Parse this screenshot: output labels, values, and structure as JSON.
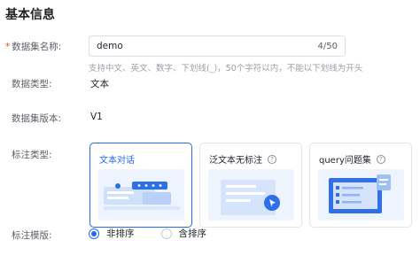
{
  "section": {
    "title": "基本信息"
  },
  "fields": {
    "name": {
      "label": "数据集名称:",
      "required_mark": "*",
      "value": "demo",
      "counter": "4/50",
      "hint": "支持中文、英文、数字、下划线(_)，50个字符以内，不能以下划线为开头"
    },
    "type": {
      "label": "数据类型:",
      "value": "文本"
    },
    "version": {
      "label": "数据集版本:",
      "value": "V1"
    },
    "annotation_type": {
      "label": "标注类型:",
      "options": [
        {
          "label": "文本对话",
          "selected": true,
          "help_icon": false
        },
        {
          "label": "泛文本无标注",
          "selected": false,
          "help_icon": true
        },
        {
          "label": "query问题集",
          "selected": false,
          "help_icon": true
        }
      ]
    },
    "template": {
      "label": "标注模版:",
      "options": [
        {
          "label": "非排序",
          "selected": true
        },
        {
          "label": "含排序",
          "selected": false
        }
      ]
    }
  },
  "colors": {
    "accent": "#2468f2",
    "required": "#e8473a",
    "illustration_bg": "#eef4fd"
  },
  "icons": {
    "help": "question-circle-icon",
    "cursor": "cursor-click-icon"
  },
  "help_glyph": "?"
}
